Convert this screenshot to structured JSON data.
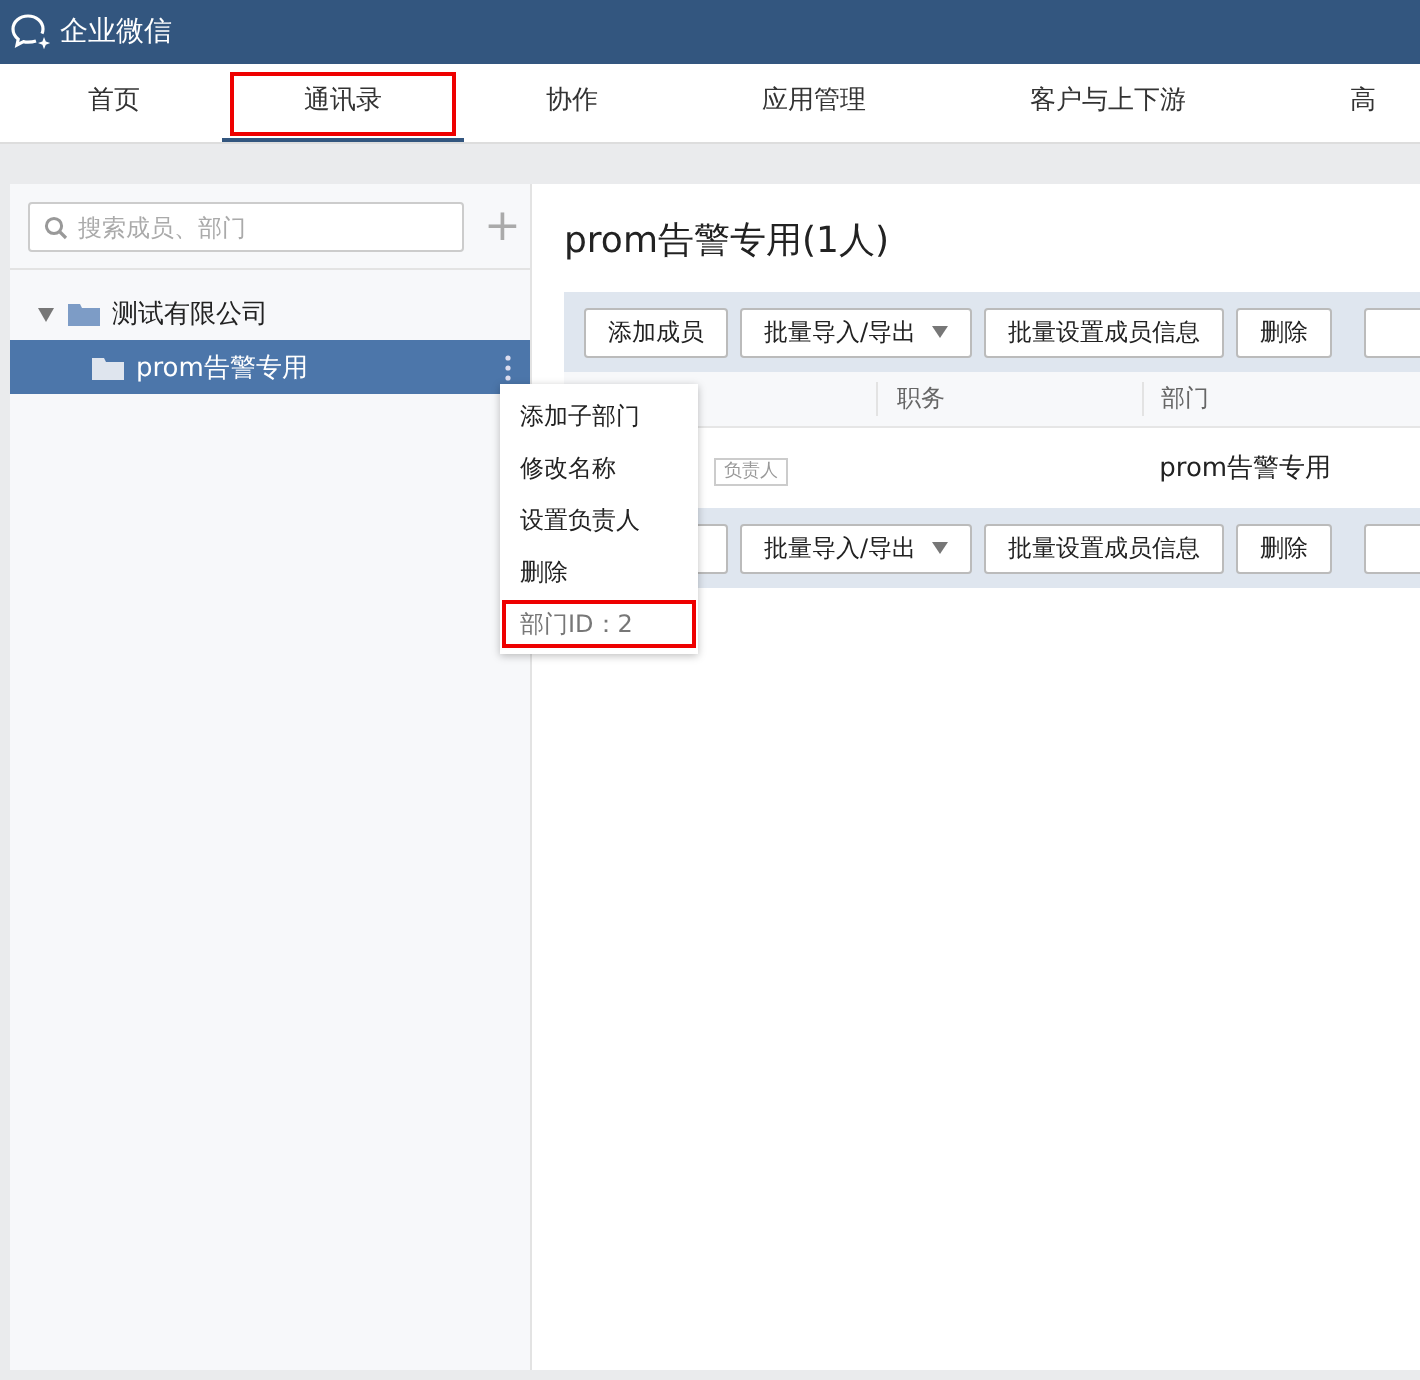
{
  "app": {
    "title": "企业微信"
  },
  "tabs": [
    {
      "label": "首页",
      "selected": false,
      "highlighted": false
    },
    {
      "label": "通讯录",
      "selected": true,
      "highlighted": true
    },
    {
      "label": "协作",
      "selected": false,
      "highlighted": false
    },
    {
      "label": "应用管理",
      "selected": false,
      "highlighted": false
    },
    {
      "label": "客户与上下游",
      "selected": false,
      "highlighted": false
    },
    {
      "label": "高",
      "selected": false,
      "highlighted": false
    }
  ],
  "sidebar": {
    "search": {
      "placeholder": "搜索成员、部门"
    },
    "add_button": "+",
    "tree": [
      {
        "label": "测试有限公司",
        "expanded": true,
        "selected": false,
        "children": [
          {
            "label": "prom告警专用",
            "selected": true
          }
        ]
      }
    ]
  },
  "context_menu": {
    "items": [
      {
        "label": "添加子部门",
        "kind": "action",
        "highlighted": false
      },
      {
        "label": "修改名称",
        "kind": "action",
        "highlighted": false
      },
      {
        "label": "设置负责人",
        "kind": "action",
        "highlighted": false
      },
      {
        "label": "删除",
        "kind": "action",
        "highlighted": false
      },
      {
        "label": "部门ID：2",
        "kind": "info",
        "highlighted": true
      }
    ]
  },
  "main": {
    "title": "prom告警专用(1人)",
    "toolbar_top": [
      {
        "label": "添加成员",
        "dropdown": false
      },
      {
        "label": "批量导入/导出",
        "dropdown": true
      },
      {
        "label": "批量设置成员信息",
        "dropdown": false
      },
      {
        "label": "删除",
        "dropdown": false
      }
    ],
    "table": {
      "columns": [
        "职务",
        "部门"
      ],
      "rows": [
        {
          "tag": "负责人",
          "department": "prom告警专用"
        }
      ]
    },
    "toolbar_bottom": [
      {
        "label": "批量导入/导出",
        "dropdown": true
      },
      {
        "label": "批量设置成员信息",
        "dropdown": false
      },
      {
        "label": "删除",
        "dropdown": false
      }
    ]
  }
}
